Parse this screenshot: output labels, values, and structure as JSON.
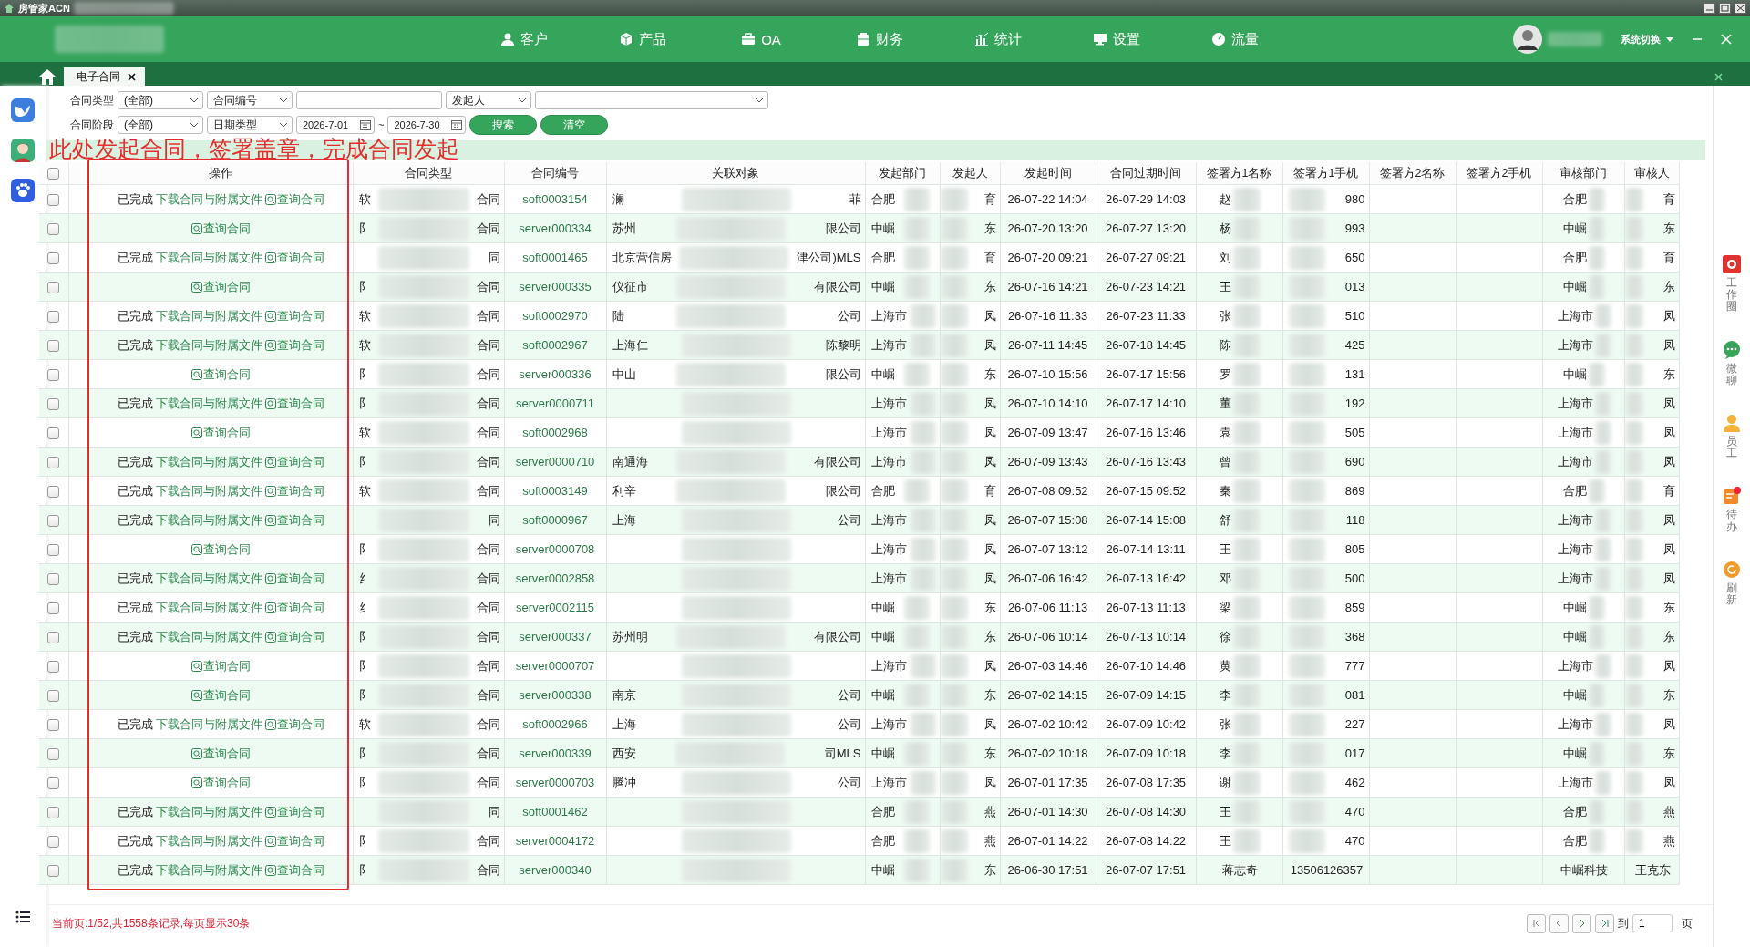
{
  "app": {
    "title": "房管家ACN"
  },
  "nav": {
    "items": [
      {
        "label": "客户"
      },
      {
        "label": "产品"
      },
      {
        "label": "OA"
      },
      {
        "label": "财务"
      },
      {
        "label": "统计"
      },
      {
        "label": "设置"
      },
      {
        "label": "流量"
      }
    ],
    "switch_label": "系统切换"
  },
  "tabs": [
    {
      "label": "电子合同",
      "selected": true
    }
  ],
  "filters": {
    "rows": [
      [
        {
          "kind": "label",
          "text": "合同类型"
        },
        {
          "kind": "select",
          "value": "(全部)"
        },
        {
          "kind": "select",
          "value": "合同编号"
        },
        {
          "kind": "input"
        },
        {
          "kind": "select",
          "value": "发起人"
        },
        {
          "kind": "select",
          "wide": true
        }
      ],
      [
        {
          "kind": "label",
          "text": "合同阶段"
        },
        {
          "kind": "select",
          "value": "(全部)"
        },
        {
          "kind": "select",
          "value": "日期类型"
        },
        {
          "kind": "date",
          "value": "2026-7-01"
        },
        {
          "kind": "sep",
          "text": "~"
        },
        {
          "kind": "date",
          "value": "2026-7-30"
        },
        {
          "kind": "button",
          "text": "搜索"
        },
        {
          "kind": "button",
          "text": "清空"
        }
      ]
    ]
  },
  "annotation": "此处发起合同，签署盖章，完成合同发起",
  "table": {
    "header_checked": false,
    "columns": [
      "操作",
      "合同类型",
      "合同编号",
      "关联对象",
      "发起部门",
      "发起人",
      "发起时间",
      "合同过期时间",
      "签署方1名称",
      "签署方1手机",
      "签署方2名称",
      "签署方2手机",
      "审核部门",
      "审核人"
    ],
    "rows": [
      {
        "checked": false,
        "kind": "full",
        "status": "已完成",
        "download": "下载合同与附属文件",
        "query": "查询合同",
        "type_head": "软",
        "type_tail": "合同",
        "number": "soft0003154",
        "related_head": "澜",
        "related_tail": "菲",
        "dept": "合肥",
        "initiator": "育",
        "start": "26-07-22 14:04",
        "expire": "26-07-29 14:03",
        "signer1_name": "赵",
        "signer1_phone": "980",
        "audit_dept": "合肥",
        "auditor": "育",
        "masked": true
      },
      {
        "checked": false,
        "kind": "query",
        "query": "查询合同",
        "type_head": "阝",
        "type_tail": "合同",
        "number": "server000334",
        "related_head": "苏州",
        "related_tail": "限公司",
        "dept": "中崛",
        "initiator": "东",
        "start": "26-07-20 13:20",
        "expire": "26-07-27 13:20",
        "signer1_name": "杨",
        "signer1_phone": "993",
        "audit_dept": "中崛",
        "auditor": "东",
        "masked": true
      },
      {
        "checked": false,
        "kind": "full",
        "status": "已完成",
        "download": "下载合同与附属文件",
        "query": "查询合同",
        "type_tail": "同",
        "number": "soft0001465",
        "related_head": "北京营信房",
        "related_tail": "津公司)MLS",
        "dept": "合肥",
        "initiator": "育",
        "start": "26-07-20 09:21",
        "expire": "26-07-27 09:21",
        "signer1_name": "刘",
        "signer1_phone": "650",
        "audit_dept": "合肥",
        "auditor": "育",
        "masked": true
      },
      {
        "checked": false,
        "kind": "query",
        "query": "查询合同",
        "type_head": "阝",
        "type_tail": "合同",
        "number": "server000335",
        "related_head": "仪征市",
        "related_tail": "有限公司",
        "dept": "中崛",
        "initiator": "东",
        "start": "26-07-16 14:21",
        "expire": "26-07-23 14:21",
        "signer1_name": "王",
        "signer1_phone": "013",
        "audit_dept": "中崛",
        "auditor": "东",
        "masked": true
      },
      {
        "checked": false,
        "kind": "full",
        "status": "已完成",
        "download": "下载合同与附属文件",
        "query": "查询合同",
        "type_head": "软",
        "type_tail": "合同",
        "number": "soft0002970",
        "related_head": "陆",
        "related_tail": "公司",
        "dept": "上海市",
        "initiator": "凤",
        "start": "26-07-16 11:33",
        "expire": "26-07-23 11:33",
        "signer1_name": "张",
        "signer1_phone": "510",
        "audit_dept": "上海市",
        "auditor": "凤",
        "masked": true
      },
      {
        "checked": false,
        "kind": "full",
        "status": "已完成",
        "download": "下载合同与附属文件",
        "query": "查询合同",
        "type_head": "软",
        "type_tail": "合同",
        "number": "soft0002967",
        "related_head": "上海仁",
        "related_tail": "陈黎明",
        "dept": "上海市",
        "initiator": "凤",
        "start": "26-07-11 14:45",
        "expire": "26-07-18 14:45",
        "signer1_name": "陈",
        "signer1_phone": "425",
        "audit_dept": "上海市",
        "auditor": "凤",
        "masked": true
      },
      {
        "checked": false,
        "kind": "query",
        "query": "查询合同",
        "type_head": "阝",
        "type_tail": "合同",
        "number": "server000336",
        "related_head": "中山",
        "related_tail": "限公司",
        "dept": "中崛",
        "initiator": "东",
        "start": "26-07-10 15:56",
        "expire": "26-07-17 15:56",
        "signer1_name": "罗",
        "signer1_phone": "131",
        "audit_dept": "中崛",
        "auditor": "东",
        "masked": true
      },
      {
        "checked": false,
        "kind": "full",
        "status": "已完成",
        "download": "下载合同与附属文件",
        "query": "查询合同",
        "type_head": "阝",
        "type_tail": "合同",
        "number": "server0000711",
        "dept": "上海市",
        "initiator": "凤",
        "start": "26-07-10 14:10",
        "expire": "26-07-17 14:10",
        "signer1_name": "董",
        "signer1_phone": "192",
        "audit_dept": "上海市",
        "auditor": "凤",
        "masked": true
      },
      {
        "checked": false,
        "kind": "query",
        "query": "查询合同",
        "type_head": "软",
        "type_tail": "合同",
        "number": "soft0002968",
        "dept": "上海市",
        "initiator": "凤",
        "start": "26-07-09 13:47",
        "expire": "26-07-16 13:46",
        "signer1_name": "袁",
        "signer1_phone": "505",
        "audit_dept": "上海市",
        "auditor": "凤",
        "masked": true
      },
      {
        "checked": false,
        "kind": "full",
        "status": "已完成",
        "download": "下载合同与附属文件",
        "query": "查询合同",
        "type_head": "阝",
        "type_tail": "合同",
        "number": "server0000710",
        "related_head": "南通海",
        "related_tail": "有限公司",
        "dept": "上海市",
        "initiator": "凤",
        "start": "26-07-09 13:43",
        "expire": "26-07-16 13:43",
        "signer1_name": "曾",
        "signer1_phone": "690",
        "audit_dept": "上海市",
        "auditor": "凤",
        "masked": true
      },
      {
        "checked": false,
        "kind": "full",
        "status": "已完成",
        "download": "下载合同与附属文件",
        "query": "查询合同",
        "type_head": "软",
        "type_tail": "合同",
        "number": "soft0003149",
        "related_head": "利辛",
        "related_tail": "限公司",
        "dept": "合肥",
        "initiator": "育",
        "start": "26-07-08 09:52",
        "expire": "26-07-15 09:52",
        "signer1_name": "秦",
        "signer1_phone": "869",
        "audit_dept": "合肥",
        "auditor": "育",
        "masked": true
      },
      {
        "checked": false,
        "kind": "full",
        "status": "已完成",
        "download": "下载合同与附属文件",
        "query": "查询合同",
        "type_tail": "同",
        "number": "soft0000967",
        "related_head": "上海",
        "related_tail": "公司",
        "dept": "上海市",
        "initiator": "凤",
        "start": "26-07-07 15:08",
        "expire": "26-07-14 15:08",
        "signer1_name": "舒",
        "signer1_phone": "118",
        "audit_dept": "上海市",
        "auditor": "凤",
        "masked": true
      },
      {
        "checked": false,
        "kind": "query",
        "query": "查询合同",
        "type_head": "阝",
        "type_tail": "合同",
        "number": "server0000708",
        "dept": "上海市",
        "initiator": "凤",
        "start": "26-07-07 13:12",
        "expire": "26-07-14 13:11",
        "signer1_name": "王",
        "signer1_phone": "805",
        "audit_dept": "上海市",
        "auditor": "凤",
        "masked": true
      },
      {
        "checked": false,
        "kind": "full",
        "status": "已完成",
        "download": "下载合同与附属文件",
        "query": "查询合同",
        "type_head": "纟",
        "type_tail": "合同",
        "number": "server0002858",
        "dept": "上海市",
        "initiator": "凤",
        "start": "26-07-06 16:42",
        "expire": "26-07-13 16:42",
        "signer1_name": "邓",
        "signer1_phone": "500",
        "audit_dept": "上海市",
        "auditor": "凤",
        "masked": true
      },
      {
        "checked": false,
        "kind": "full",
        "status": "已完成",
        "download": "下载合同与附属文件",
        "query": "查询合同",
        "type_head": "纟",
        "type_tail": "合同",
        "number": "server0002115",
        "dept": "中崛",
        "initiator": "东",
        "start": "26-07-06 11:13",
        "expire": "26-07-13 11:13",
        "signer1_name": "梁",
        "signer1_phone": "859",
        "audit_dept": "中崛",
        "auditor": "东",
        "masked": true
      },
      {
        "checked": false,
        "kind": "full",
        "status": "已完成",
        "download": "下载合同与附属文件",
        "query": "查询合同",
        "type_head": "阝",
        "type_tail": "合同",
        "number": "server000337",
        "related_head": "苏州明",
        "related_tail": "有限公司",
        "dept": "中崛",
        "initiator": "东",
        "start": "26-07-06 10:14",
        "expire": "26-07-13 10:14",
        "signer1_name": "徐",
        "signer1_phone": "368",
        "audit_dept": "中崛",
        "auditor": "东",
        "masked": true
      },
      {
        "checked": false,
        "kind": "query",
        "query": "查询合同",
        "type_head": "阝",
        "type_tail": "合同",
        "number": "server0000707",
        "dept": "上海市",
        "initiator": "凤",
        "start": "26-07-03 14:46",
        "expire": "26-07-10 14:46",
        "signer1_name": "黄",
        "signer1_phone": "777",
        "audit_dept": "上海市",
        "auditor": "凤",
        "masked": true
      },
      {
        "checked": false,
        "kind": "query",
        "query": "查询合同",
        "type_head": "阝",
        "type_tail": "合同",
        "number": "server000338",
        "related_head": "南京",
        "related_tail": "公司",
        "dept": "中崛",
        "initiator": "东",
        "start": "26-07-02 14:15",
        "expire": "26-07-09 14:15",
        "signer1_name": "李",
        "signer1_phone": "081",
        "audit_dept": "中崛",
        "auditor": "东",
        "masked": true
      },
      {
        "checked": false,
        "kind": "full",
        "status": "已完成",
        "download": "下载合同与附属文件",
        "query": "查询合同",
        "type_head": "软",
        "type_tail": "合同",
        "number": "soft0002966",
        "related_head": "上海",
        "related_tail": "公司",
        "dept": "上海市",
        "initiator": "凤",
        "start": "26-07-02 10:42",
        "expire": "26-07-09 10:42",
        "signer1_name": "张",
        "signer1_phone": "227",
        "audit_dept": "上海市",
        "auditor": "凤",
        "masked": true
      },
      {
        "checked": false,
        "kind": "query",
        "query": "查询合同",
        "type_head": "阝",
        "type_tail": "合同",
        "number": "server000339",
        "related_head": "西安",
        "related_tail": "司MLS",
        "dept": "中崛",
        "initiator": "东",
        "start": "26-07-02 10:18",
        "expire": "26-07-09 10:18",
        "signer1_name": "李",
        "signer1_phone": "017",
        "audit_dept": "中崛",
        "auditor": "东",
        "masked": true
      },
      {
        "checked": false,
        "kind": "query",
        "query": "查询合同",
        "type_head": "阝",
        "type_tail": "合同",
        "number": "server0000703",
        "related_head": "腾冲",
        "related_tail": "公司",
        "dept": "上海市",
        "initiator": "凤",
        "start": "26-07-01 17:35",
        "expire": "26-07-08 17:35",
        "signer1_name": "谢",
        "signer1_phone": "462",
        "audit_dept": "上海市",
        "auditor": "凤",
        "masked": true
      },
      {
        "checked": false,
        "kind": "full",
        "status": "已完成",
        "download": "下载合同与附属文件",
        "query": "查询合同",
        "type_tail": "同",
        "number": "soft0001462",
        "dept": "合肥",
        "initiator": "燕",
        "start": "26-07-01 14:30",
        "expire": "26-07-08 14:30",
        "signer1_name": "王",
        "signer1_phone": "470",
        "audit_dept": "合肥",
        "auditor": "燕",
        "masked": true
      },
      {
        "checked": false,
        "kind": "full",
        "status": "已完成",
        "download": "下载合同与附属文件",
        "query": "查询合同",
        "type_head": "阝",
        "type_tail": "合同",
        "number": "server0004172",
        "dept": "合肥",
        "initiator": "燕",
        "start": "26-07-01 14:22",
        "expire": "26-07-08 14:22",
        "signer1_name": "王",
        "signer1_phone": "470",
        "audit_dept": "合肥",
        "auditor": "燕",
        "masked": true
      },
      {
        "checked": false,
        "kind": "full",
        "status": "已完成",
        "download": "下载合同与附属文件",
        "query": "查询合同",
        "type_head": "阝",
        "type_tail": "合同",
        "number": "server000340",
        "dept": "中崛",
        "initiator": "东",
        "start": "26-06-30 17:51",
        "expire": "26-07-07 17:51",
        "signer1_name": "蒋志奇",
        "signer1_phone": "13506126357",
        "audit_dept": "中崛科技",
        "auditor": "王克东",
        "masked": false
      }
    ]
  },
  "footer": {
    "summary": "当前页:1/52,共1558条记录,每页显示30条",
    "goto_label": "到",
    "page": "1",
    "page_suffix": "页"
  },
  "right_rail": [
    {
      "label": "工作圈"
    },
    {
      "label": "微聊"
    },
    {
      "label": "员工"
    },
    {
      "label": "待办"
    },
    {
      "label": "刷新"
    }
  ]
}
